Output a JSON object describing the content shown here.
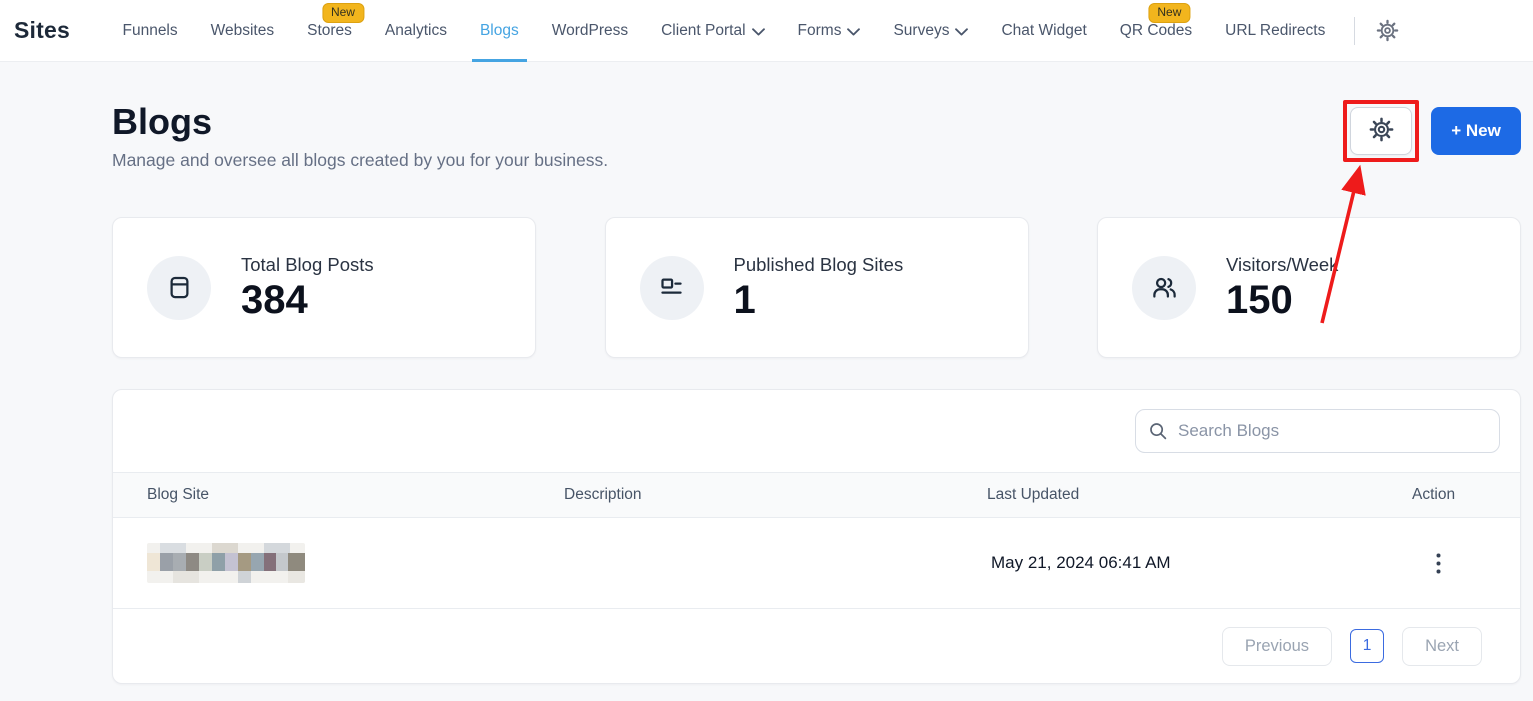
{
  "nav": {
    "brand": "Sites",
    "items": [
      {
        "label": "Funnels"
      },
      {
        "label": "Websites"
      },
      {
        "label": "Stores",
        "badge": "New"
      },
      {
        "label": "Analytics"
      },
      {
        "label": "Blogs",
        "active": true
      },
      {
        "label": "WordPress"
      },
      {
        "label": "Client Portal",
        "chevron": true
      },
      {
        "label": "Forms",
        "chevron": true
      },
      {
        "label": "Surveys",
        "chevron": true
      },
      {
        "label": "Chat Widget"
      },
      {
        "label": "QR Codes",
        "badge": "New"
      },
      {
        "label": "URL Redirects"
      }
    ],
    "settings_icon": "gear-icon"
  },
  "page": {
    "title": "Blogs",
    "subtitle": "Manage and oversee all blogs created by you for your business.",
    "new_button_label": "+ New",
    "settings_button_icon": "gear-icon"
  },
  "stats": [
    {
      "label": "Total Blog Posts",
      "value": "384",
      "icon": "blog-posts-icon"
    },
    {
      "label": "Published Blog Sites",
      "value": "1",
      "icon": "published-sites-icon"
    },
    {
      "label": "Visitors/Week",
      "value": "150",
      "icon": "visitors-icon"
    }
  ],
  "table": {
    "search_placeholder": "Search Blogs",
    "columns": [
      "Blog Site",
      "Description",
      "Last Updated",
      "Action"
    ],
    "rows": [
      {
        "blog_site_redacted": true,
        "description": "",
        "last_updated": "May 21, 2024 06:41 AM",
        "action_icon": "kebab-menu-icon"
      }
    ]
  },
  "pagination": {
    "previous": "Previous",
    "page": "1",
    "next": "Next"
  },
  "annotation": {
    "shape": "red box around settings button with arrow",
    "color": "#ee1b1b"
  },
  "colors": {
    "accent_blue": "#1d6ae5",
    "active_tab_blue": "#45a4e2",
    "badge_yellow": "#f2b51d",
    "annotation_red": "#ee1b1b",
    "page_background": "#f7f8fa"
  }
}
